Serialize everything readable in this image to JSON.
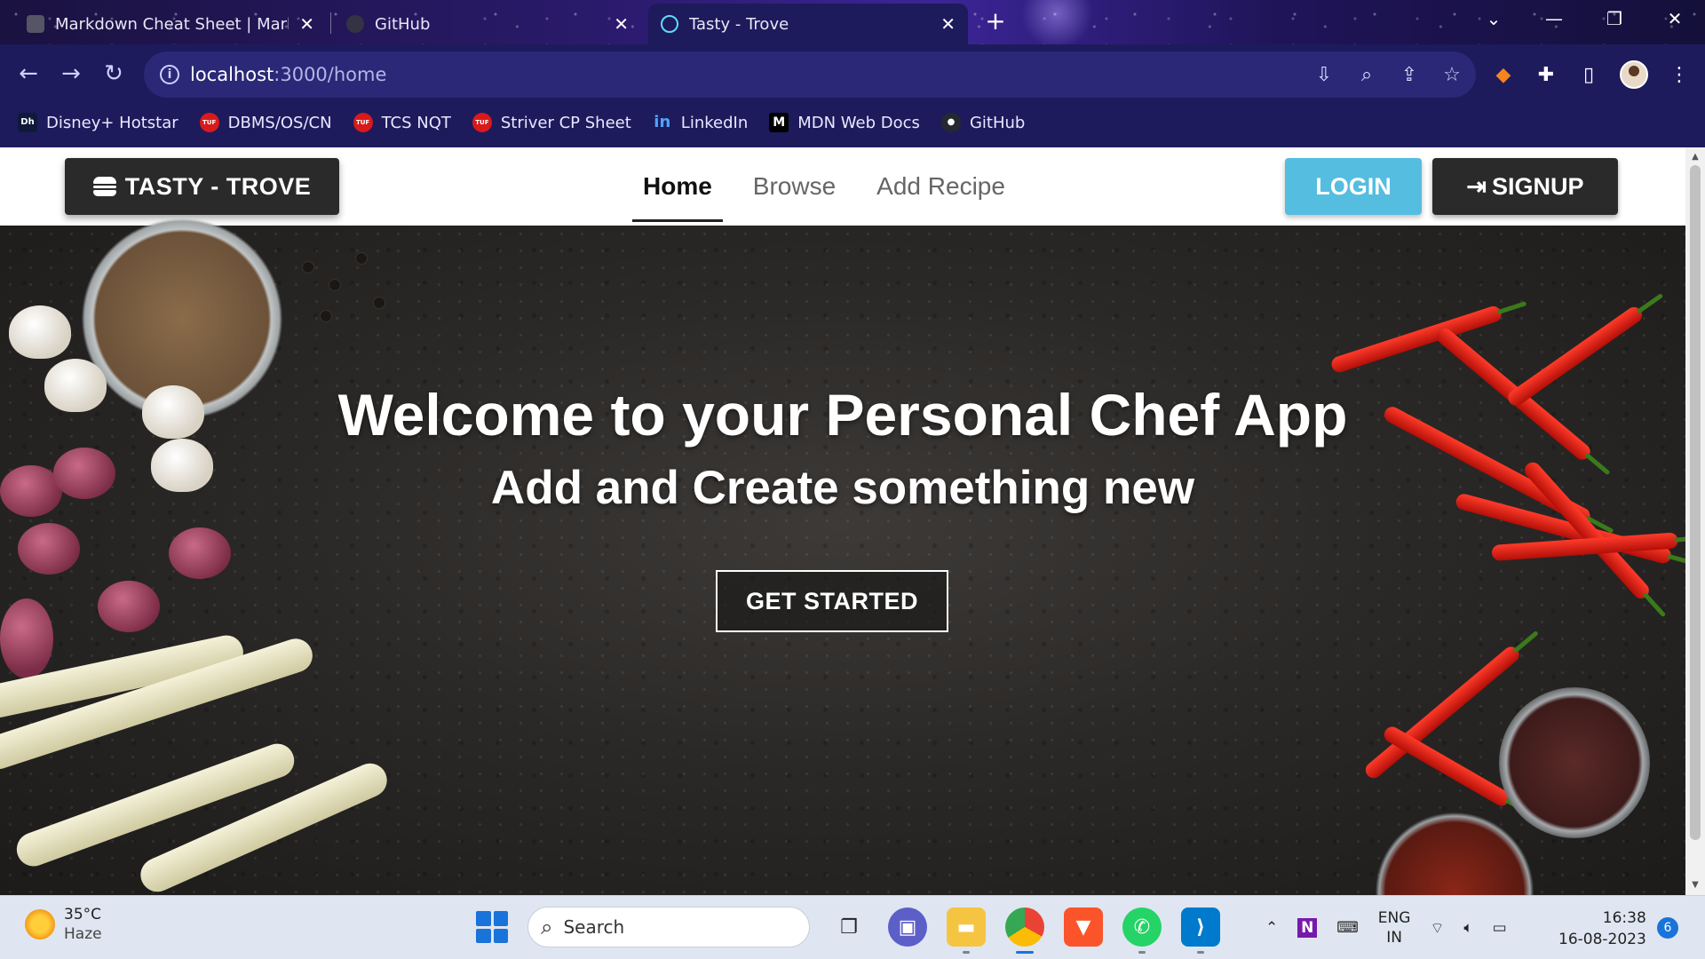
{
  "browser": {
    "tabs": [
      {
        "title": "Markdown Cheat Sheet | Markdo",
        "favicon_color": "#555566",
        "active": false
      },
      {
        "title": "GitHub",
        "favicon_color": "#333344",
        "active": false
      },
      {
        "title": "Tasty - Trove",
        "favicon_color": "#61dafb",
        "active": true
      }
    ],
    "new_tab_label": "+",
    "url_host": "localhost",
    "url_path": ":3000/home",
    "bookmarks": [
      {
        "label": "Disney+ Hotstar",
        "icon": "hotstar-icon",
        "color": "#0f1a3a",
        "glyph": "Dh"
      },
      {
        "label": "DBMS/OS/CN",
        "icon": "tuf-icon",
        "color": "#d91a1a",
        "glyph": "TUF"
      },
      {
        "label": "TCS NQT",
        "icon": "tuf-icon",
        "color": "#d91a1a",
        "glyph": "TUF"
      },
      {
        "label": "Striver CP Sheet",
        "icon": "tuf-icon",
        "color": "#d91a1a",
        "glyph": "TUF"
      },
      {
        "label": "LinkedIn",
        "icon": "linkedin-icon",
        "color": "#0a66c2",
        "glyph": "in"
      },
      {
        "label": "MDN Web Docs",
        "icon": "mdn-icon",
        "color": "#000000",
        "glyph": "M"
      },
      {
        "label": "GitHub",
        "icon": "github-icon",
        "color": "#24292f",
        "glyph": "●"
      }
    ]
  },
  "site": {
    "brand": "TASTY - TROVE",
    "nav": [
      {
        "label": "Home",
        "active": true
      },
      {
        "label": "Browse",
        "active": false
      },
      {
        "label": "Add Recipe",
        "active": false
      }
    ],
    "login_label": "LOGIN",
    "signup_label": "SIGNUP",
    "hero_title": "Welcome to your Personal Chef App",
    "hero_subtitle": "Add and Create something new",
    "cta_label": "GET STARTED",
    "colors": {
      "login": "#55bde0",
      "dark": "#2a2a2a"
    }
  },
  "taskbar": {
    "weather_temp": "35°C",
    "weather_cond": "Haze",
    "search_placeholder": "Search",
    "lang_1": "ENG",
    "lang_2": "IN",
    "time": "16:38",
    "date": "16-08-2023",
    "notifications": "6"
  }
}
